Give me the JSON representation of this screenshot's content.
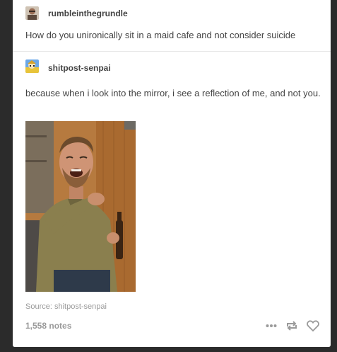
{
  "post1": {
    "username": "rumbleinthegrundle",
    "text": "How do you unironically sit in a maid cafe and not consider suicide",
    "avatar_icon": "user-avatar-photo"
  },
  "post2": {
    "username": "shitpost-senpai",
    "text": "because when i look into the mirror, i see a reflection of me, and not you.",
    "avatar_icon": "anime-avatar"
  },
  "media": {
    "description_icon": "photo-laughing-man-pointing"
  },
  "footer": {
    "source_text": "Source: shitpost-senpai",
    "notes_text": "1,558 notes",
    "more_icon": "more-icon",
    "reblog_icon": "reblog-icon",
    "like_icon": "heart-icon"
  },
  "colors": {
    "background": "#2b2b2b",
    "card": "#ffffff",
    "text": "#444444",
    "muted": "#9a9a9a"
  }
}
